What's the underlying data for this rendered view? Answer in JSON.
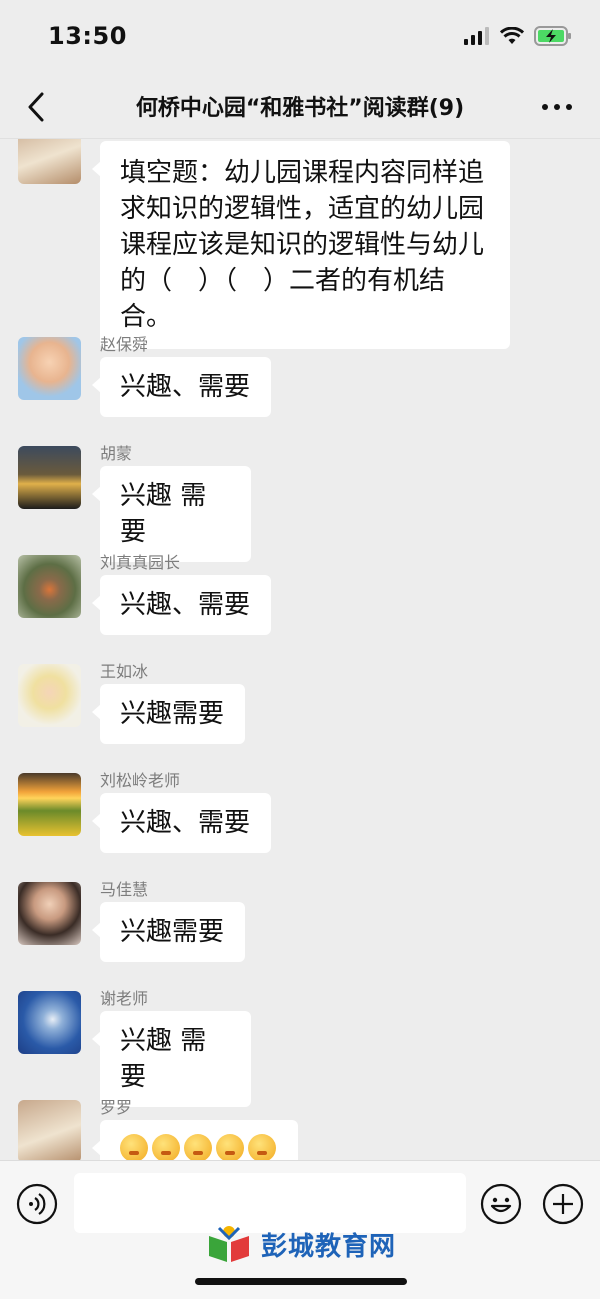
{
  "status": {
    "time": "13:50"
  },
  "nav": {
    "title": "何桥中心园“和雅书社”阅读群(9)"
  },
  "messages": [
    {
      "sender": "",
      "text": "填空题：幼儿园课程内容同样追求知识的逻辑性，适宜的幼儿园课程应该是知识的逻辑性与幼儿的（　）（　）二者的有机结合。"
    },
    {
      "sender": "赵保舜",
      "text": "兴趣、需要"
    },
    {
      "sender": "胡蒙",
      "text": "兴趣 需要"
    },
    {
      "sender": "刘真真园长",
      "text": "兴趣、需要"
    },
    {
      "sender": "王如冰",
      "text": "兴趣需要"
    },
    {
      "sender": "刘松岭老师",
      "text": "兴趣、需要"
    },
    {
      "sender": "马佳慧",
      "text": "兴趣需要"
    },
    {
      "sender": "谢老师",
      "text": "兴趣 需要"
    },
    {
      "sender": "罗罗",
      "text": "",
      "emoji_count": 5,
      "emoji_icon": "grinning-face-icon"
    }
  ],
  "watermark": {
    "text": "彭城教育网"
  },
  "colors": {
    "background": "#ededed",
    "bubble": "#ffffff",
    "sender": "#7d7d7d",
    "watermark": "#1e63b8"
  }
}
